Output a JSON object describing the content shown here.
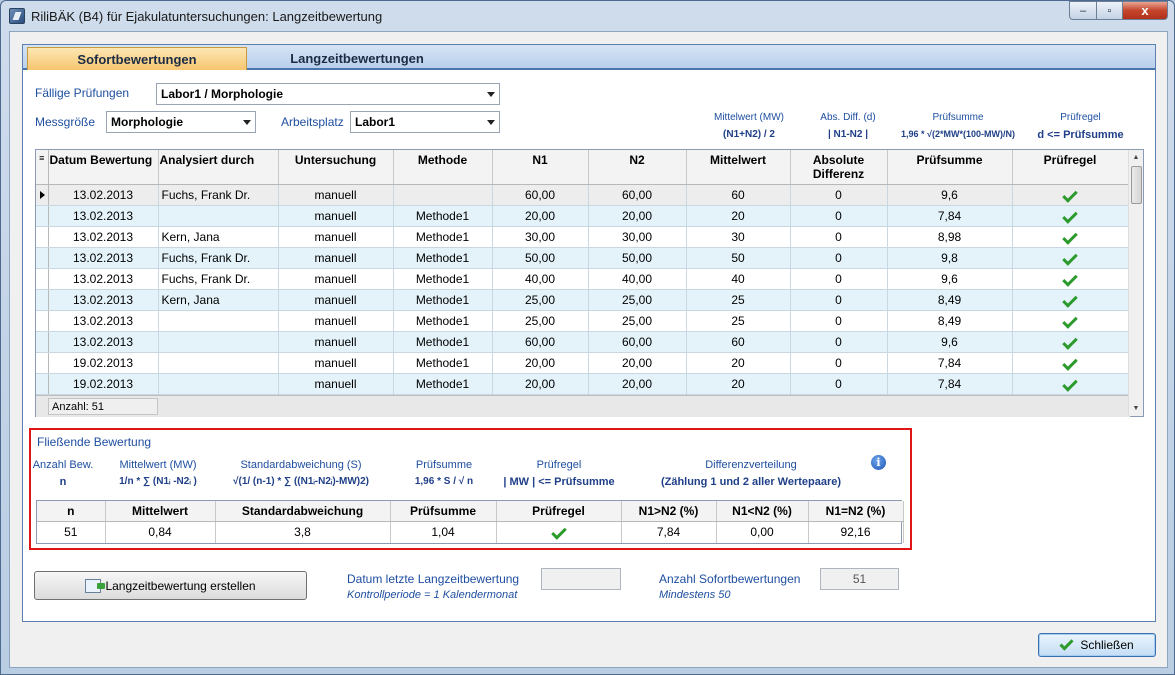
{
  "window": {
    "title": "RiliBÄK (B4) für Ejakulatuntersuchungen: Langzeitbewertung",
    "min": "–",
    "max": "▫",
    "close": "x"
  },
  "tabs": [
    {
      "label": "Sofortbewertungen"
    },
    {
      "label": "Langzeitbewertungen"
    }
  ],
  "filters": {
    "faellige_label": "Fällige Prüfungen",
    "faellige_value": "Labor1 / Morphologie",
    "messgroesse_label": "Messgröße",
    "messgroesse_value": "Morphologie",
    "arbeitsplatz_label": "Arbeitsplatz",
    "arbeitsplatz_value": "Labor1"
  },
  "formulas": {
    "mw_h": "Mittelwert (MW)",
    "mw_b": "(N1+N2) / 2",
    "diff_h": "Abs. Diff. (d)",
    "diff_b": "| N1-N2 |",
    "ps_h": "Prüfsumme",
    "ps_b": "1,96 * √(2*MW*(100-MW)/N)",
    "pr_h": "Prüfregel",
    "pr_b": "d <= Prüfsumme"
  },
  "grid": {
    "columns": [
      "Datum Bewertung",
      "Analysiert durch",
      "Untersuchung",
      "Methode",
      "N1",
      "N2",
      "Mittelwert",
      "Absolute Differenz",
      "Prüfsumme",
      "Prüfregel"
    ],
    "rows": [
      {
        "datum": "13.02.2013",
        "analysiert": "Fuchs, Frank Dr.",
        "unters": "manuell",
        "methode": "",
        "n1": "60,00",
        "n2": "60,00",
        "mw": "60",
        "diff": "0",
        "ps": "9,6"
      },
      {
        "datum": "13.02.2013",
        "analysiert": "",
        "unters": "manuell",
        "methode": "Methode1",
        "n1": "20,00",
        "n2": "20,00",
        "mw": "20",
        "diff": "0",
        "ps": "7,84"
      },
      {
        "datum": "13.02.2013",
        "analysiert": "Kern, Jana",
        "unters": "manuell",
        "methode": "Methode1",
        "n1": "30,00",
        "n2": "30,00",
        "mw": "30",
        "diff": "0",
        "ps": "8,98"
      },
      {
        "datum": "13.02.2013",
        "analysiert": "Fuchs, Frank Dr.",
        "unters": "manuell",
        "methode": "Methode1",
        "n1": "50,00",
        "n2": "50,00",
        "mw": "50",
        "diff": "0",
        "ps": "9,8"
      },
      {
        "datum": "13.02.2013",
        "analysiert": "Fuchs, Frank Dr.",
        "unters": "manuell",
        "methode": "Methode1",
        "n1": "40,00",
        "n2": "40,00",
        "mw": "40",
        "diff": "0",
        "ps": "9,6"
      },
      {
        "datum": "13.02.2013",
        "analysiert": "Kern, Jana",
        "unters": "manuell",
        "methode": "Methode1",
        "n1": "25,00",
        "n2": "25,00",
        "mw": "25",
        "diff": "0",
        "ps": "8,49"
      },
      {
        "datum": "13.02.2013",
        "analysiert": "",
        "unters": "manuell",
        "methode": "Methode1",
        "n1": "25,00",
        "n2": "25,00",
        "mw": "25",
        "diff": "0",
        "ps": "8,49"
      },
      {
        "datum": "13.02.2013",
        "analysiert": "",
        "unters": "manuell",
        "methode": "Methode1",
        "n1": "60,00",
        "n2": "60,00",
        "mw": "60",
        "diff": "0",
        "ps": "9,6"
      },
      {
        "datum": "19.02.2013",
        "analysiert": "",
        "unters": "manuell",
        "methode": "Methode1",
        "n1": "20,00",
        "n2": "20,00",
        "mw": "20",
        "diff": "0",
        "ps": "7,84"
      },
      {
        "datum": "19.02.2013",
        "analysiert": "",
        "unters": "manuell",
        "methode": "Methode1",
        "n1": "20,00",
        "n2": "20,00",
        "mw": "20",
        "diff": "0",
        "ps": "7,84"
      }
    ],
    "count": "Anzahl: 51"
  },
  "floating": {
    "title": "Fließende Bewertung",
    "h_anzahl": "Anzahl Bew.",
    "b_anzahl": "n",
    "h_mw": "Mittelwert (MW)",
    "b_mw": "1/n * ∑ (N1ᵢ -N2ᵢ )",
    "h_std": "Standardabweichung (S)",
    "b_std": "√(1/ (n-1) * ∑ ((N1ᵢ-N2ᵢ)-MW)2)",
    "h_ps": "Prüfsumme",
    "b_ps": "1,96 * S / √ n",
    "h_pr": "Prüfregel",
    "b_pr": "| MW | <= Prüfsumme",
    "h_dv": "Differenzverteilung",
    "b_dv": "(Zählung 1 und 2 aller Wertepaare)",
    "columns": [
      "n",
      "Mittelwert",
      "Standardabweichung",
      "Prüfsumme",
      "Prüfregel",
      "N1>N2 (%)",
      "N1<N2 (%)",
      "N1=N2 (%)"
    ],
    "values": {
      "n": "51",
      "mw": "0,84",
      "std": "3,8",
      "ps": "1,04",
      "gt": "7,84",
      "lt": "0,00",
      "eq": "92,16"
    }
  },
  "bottom": {
    "create_label": "Langzeitbewertung erstellen",
    "datum_label": "Datum letzte Langzeitbewertung",
    "datum_sub": "Kontrollperiode = 1 Kalendermonat",
    "datum_value": "",
    "anzahl_label": "Anzahl Sofortbewertungen",
    "anzahl_sub": "Mindestens 50",
    "anzahl_value": "51",
    "close_label": "Schließen"
  }
}
